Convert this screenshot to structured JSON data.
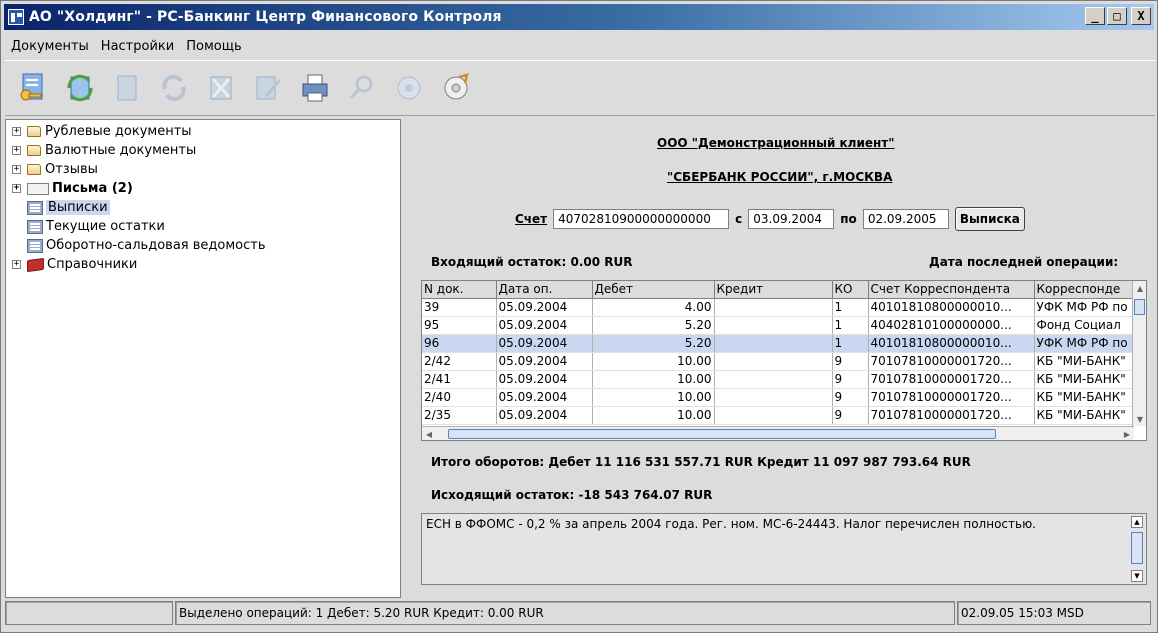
{
  "window": {
    "title": "АО \"Холдинг\" - РС-Банкинг Центр Финансового Контроля",
    "minimize": "_",
    "maximize": "□",
    "close": "X"
  },
  "menu": {
    "items": [
      "Документы",
      "Настройки",
      "Помощь"
    ]
  },
  "toolbar": {
    "icons": [
      "sign-icon",
      "refresh-icon",
      "document-icon",
      "cycle-icon",
      "delete-icon",
      "edit-icon",
      "print-icon",
      "search-icon",
      "disc-icon",
      "export-icon"
    ]
  },
  "tree": {
    "items": [
      {
        "label": "Рублевые документы",
        "icon": "folder-icon",
        "expandable": true
      },
      {
        "label": "Валютные документы",
        "icon": "folder-icon",
        "expandable": true
      },
      {
        "label": "Отзывы",
        "icon": "folder-icon",
        "expandable": true
      },
      {
        "label": "Письма (2)",
        "icon": "envelope-icon",
        "expandable": true
      },
      {
        "label": "Выписки",
        "icon": "statement-icon",
        "expandable": false
      },
      {
        "label": "Текущие остатки",
        "icon": "statement-icon",
        "expandable": false
      },
      {
        "label": "Оборотно-сальдовая ведомость",
        "icon": "statement-icon",
        "expandable": false
      },
      {
        "label": "Справочники",
        "icon": "book-icon",
        "expandable": true
      }
    ],
    "expand_glyph": "+"
  },
  "statement": {
    "client": "ООО \"Демонстрационный клиент\"",
    "bank": "\"СБЕРБАНК РОССИИ\", г.МОСКВА",
    "account_label": "Счет",
    "account": "40702810900000000000",
    "from_label": "с",
    "date_from": "03.09.2004",
    "to_label": "по",
    "date_to": "02.09.2005",
    "button": "Выписка",
    "opening_balance": "Входящий остаток: 0.00 RUR",
    "last_op_label": "Дата последней операции:",
    "totals": "Итого оборотов:  Дебет 11 116 531 557.71 RUR  Кредит 11 097 987 793.64 RUR",
    "closing_balance": "Исходящий остаток: -18 543 764.07 RUR",
    "comment": "ЕСН в ФФОМС - 0,2 % за апрель 2004 года. Рег. ном. МС-6-24443. Налог перечислен полностью."
  },
  "table": {
    "columns": [
      "N док.",
      "Дата оп.",
      "Дебет",
      "Кредит",
      "КО",
      "Счет Корреспондента",
      "Корреспонде"
    ],
    "rows": [
      [
        "39",
        "05.09.2004",
        "4.00",
        "",
        "1",
        "40101810800000010...",
        "УФК МФ РФ по"
      ],
      [
        "95",
        "05.09.2004",
        "5.20",
        "",
        "1",
        "40402810100000000...",
        "Фонд Социал"
      ],
      [
        "96",
        "05.09.2004",
        "5.20",
        "",
        "1",
        "40101810800000010...",
        "УФК МФ РФ по"
      ],
      [
        "2/42",
        "05.09.2004",
        "10.00",
        "",
        "9",
        "70107810000001720...",
        "КБ \"МИ-БАНК\""
      ],
      [
        "2/41",
        "05.09.2004",
        "10.00",
        "",
        "9",
        "70107810000001720...",
        "КБ \"МИ-БАНК\""
      ],
      [
        "2/40",
        "05.09.2004",
        "10.00",
        "",
        "9",
        "70107810000001720...",
        "КБ \"МИ-БАНК\""
      ],
      [
        "2/35",
        "05.09.2004",
        "10.00",
        "",
        "9",
        "70107810000001720...",
        "КБ \"МИ-БАНК\""
      ]
    ],
    "selected_row": 2
  },
  "status": {
    "left": "",
    "main": "Выделено операций: 1 Дебет: 5.20 RUR Кредит: 0.00 RUR",
    "datetime": "02.09.05 15:03 MSD"
  }
}
